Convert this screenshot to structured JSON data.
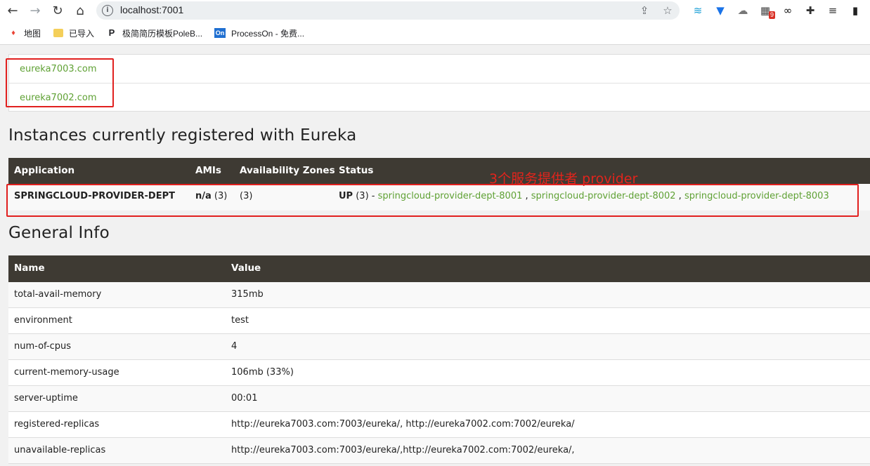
{
  "browser": {
    "url": "localhost:7001",
    "extensions": [
      {
        "name": "wifi-icon",
        "glyph": "≋",
        "color": "#1a9fd6"
      },
      {
        "name": "v-icon",
        "glyph": "▼",
        "color": "#1a73e8"
      },
      {
        "name": "cloud-icon",
        "glyph": "☁",
        "color": "#777777"
      },
      {
        "name": "grid-icon",
        "glyph": "▦",
        "color": "#444444",
        "badge": "9"
      },
      {
        "name": "infinity-icon",
        "glyph": "∞",
        "color": "#111111"
      },
      {
        "name": "puzzle-icon",
        "glyph": "✚",
        "color": "#333333"
      },
      {
        "name": "playlist-icon",
        "glyph": "≡",
        "color": "#333333"
      },
      {
        "name": "sidepanel-icon",
        "glyph": "▮",
        "color": "#222222"
      }
    ]
  },
  "bookmarks": [
    {
      "label": "地图",
      "icon": "map-pin-icon",
      "glyph": "♦",
      "color": "#34a853"
    },
    {
      "label": "已导入",
      "icon": "folder-icon",
      "glyph": "▬",
      "color": "#f2c94c"
    },
    {
      "label": "极简简历模板PoleB...",
      "icon": "poleb-icon",
      "glyph": "P",
      "color": "#111111"
    },
    {
      "label": "ProcessOn - 免费...",
      "icon": "processon-icon",
      "glyph": "On",
      "color": "#1f6fd1"
    }
  ],
  "replicas": [
    "eureka7003.com",
    "eureka7002.com"
  ],
  "instances": {
    "title": "Instances currently registered with Eureka",
    "headers": [
      "Application",
      "AMIs",
      "Availability Zones",
      "Status"
    ],
    "row": {
      "application": "SPRINGCLOUD-PROVIDER-DEPT",
      "amis_bold": "n/a",
      "amis_count": " (3)",
      "zones": "(3)",
      "status_up": "UP",
      "status_count": " (3) - ",
      "links": [
        "springcloud-provider-dept-8001",
        "springcloud-provider-dept-8002",
        "springcloud-provider-dept-8003"
      ],
      "separator": " , "
    }
  },
  "annotation": "3个服务提供者 provider",
  "general_info": {
    "title": "General Info",
    "headers": [
      "Name",
      "Value"
    ],
    "rows": [
      {
        "name": "total-avail-memory",
        "value": "315mb"
      },
      {
        "name": "environment",
        "value": "test"
      },
      {
        "name": "num-of-cpus",
        "value": "4"
      },
      {
        "name": "current-memory-usage",
        "value": "106mb (33%)"
      },
      {
        "name": "server-uptime",
        "value": "00:01"
      },
      {
        "name": "registered-replicas",
        "value": "http://eureka7003.com:7003/eureka/, http://eureka7002.com:7002/eureka/"
      },
      {
        "name": "unavailable-replicas",
        "value": "http://eureka7003.com:7003/eureka/,http://eureka7002.com:7002/eureka/,"
      }
    ]
  }
}
